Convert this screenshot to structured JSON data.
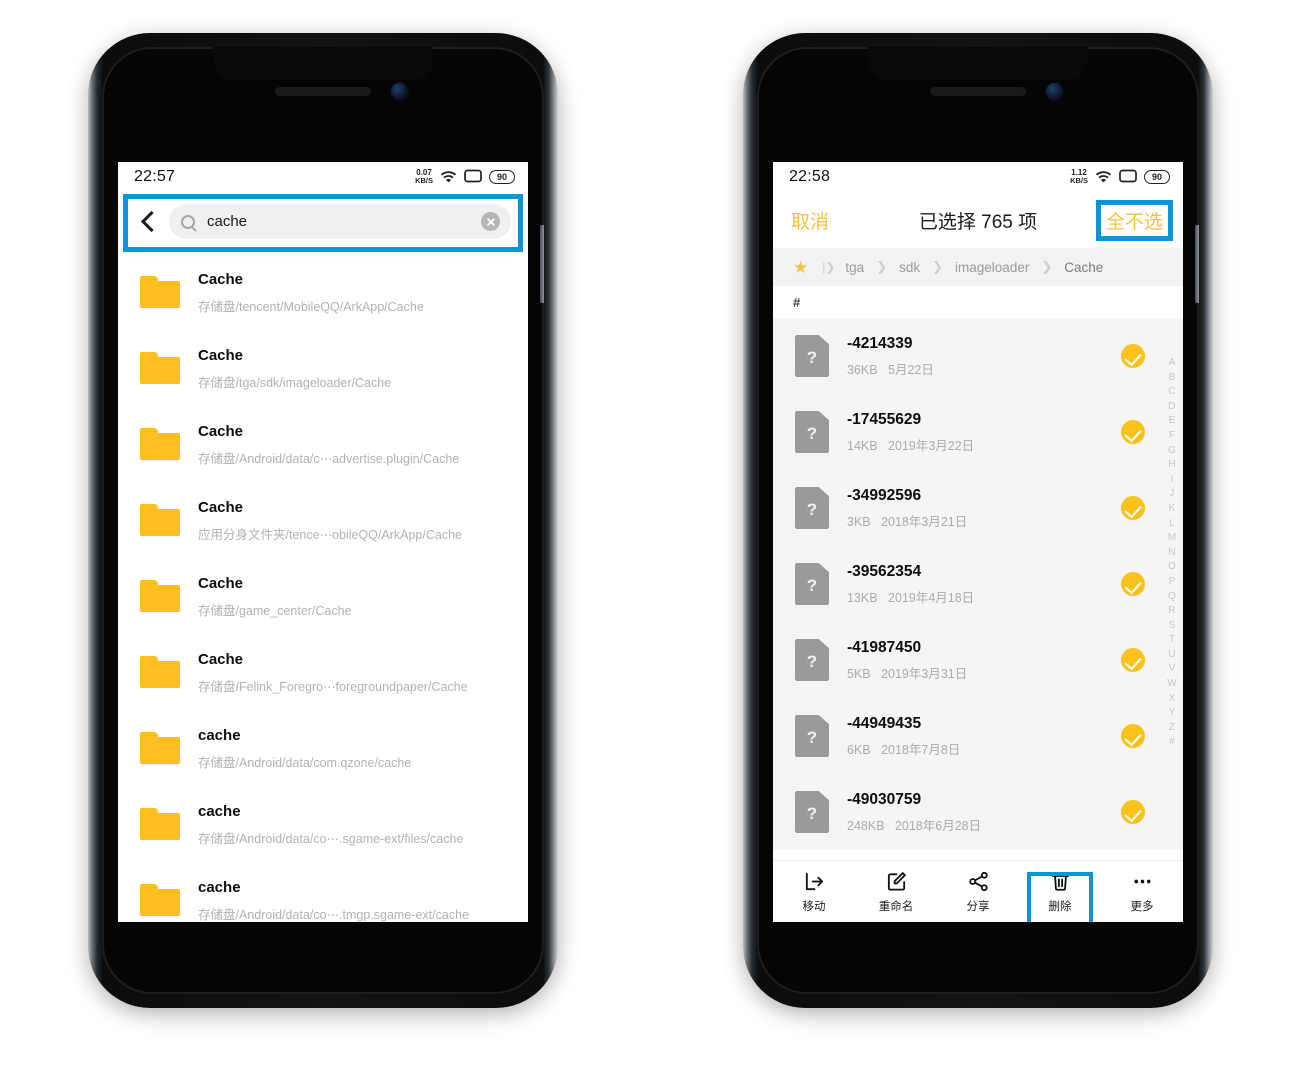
{
  "accent": {
    "highlight_blue": "#1093d6",
    "folder_yellow": "#fcbe20",
    "check_yellow": "#fdc11b",
    "text_yellow": "#f5c242"
  },
  "left_phone": {
    "status": {
      "time": "22:57",
      "net_speed_value": "0.07",
      "net_speed_unit": "KB/S",
      "wifi_icon": "wifi-icon",
      "sim_icon": "sim-icon",
      "battery": "90"
    },
    "search": {
      "back_icon": "back-chevron-icon",
      "search_icon": "search-icon",
      "value": "cache",
      "placeholder": "cache",
      "clear_icon": "clear-icon",
      "highlighted": true
    },
    "results": [
      {
        "icon": "folder-icon",
        "name": "Cache",
        "path": "存储盘/tencent/MobileQQ/ArkApp/Cache"
      },
      {
        "icon": "folder-icon",
        "name": "Cache",
        "path": "存储盘/tga/sdk/imageloader/Cache"
      },
      {
        "icon": "folder-icon",
        "name": "Cache",
        "path": "存储盘/Android/data/c⋯advertise.plugin/Cache"
      },
      {
        "icon": "folder-icon",
        "name": "Cache",
        "path": "应用分身文件夹/tence⋯obileQQ/ArkApp/Cache"
      },
      {
        "icon": "folder-icon",
        "name": "Cache",
        "path": "存储盘/game_center/Cache"
      },
      {
        "icon": "folder-icon",
        "name": "Cache",
        "path": "存储盘/Felink_Foregro⋯foregroundpaper/Cache"
      },
      {
        "icon": "folder-icon",
        "name": "cache",
        "path": "存储盘/Android/data/com.qzone/cache"
      },
      {
        "icon": "folder-icon",
        "name": "cache",
        "path": "存储盘/Android/data/co⋯.sgame-ext/files/cache"
      },
      {
        "icon": "folder-icon",
        "name": "cache",
        "path": "存储盘/Android/data/co⋯.tmgp.sgame-ext/cache"
      }
    ]
  },
  "right_phone": {
    "status": {
      "time": "22:58",
      "net_speed_value": "1.12",
      "net_speed_unit": "KB/S",
      "wifi_icon": "wifi-icon",
      "sim_icon": "sim-icon",
      "battery": "90"
    },
    "header": {
      "cancel_label": "取消",
      "title": "已选择 765 项",
      "deselect_all_label": "全不选",
      "deselect_highlighted": true
    },
    "breadcrumb": {
      "star_icon": "star-icon",
      "root_icon": "root-drive-icon",
      "items": [
        "tga",
        "sdk",
        "imageloader",
        "Cache"
      ],
      "separator": "❯"
    },
    "section_label": "#",
    "files": [
      {
        "icon": "unknown-file-icon",
        "name": "-4214339",
        "size": "36KB",
        "date": "5月22日",
        "selected": true
      },
      {
        "icon": "unknown-file-icon",
        "name": "-17455629",
        "size": "14KB",
        "date": "2019年3月22日",
        "selected": true
      },
      {
        "icon": "unknown-file-icon",
        "name": "-34992596",
        "size": "3KB",
        "date": "2018年3月21日",
        "selected": true
      },
      {
        "icon": "unknown-file-icon",
        "name": "-39562354",
        "size": "13KB",
        "date": "2019年4月18日",
        "selected": true
      },
      {
        "icon": "unknown-file-icon",
        "name": "-41987450",
        "size": "5KB",
        "date": "2019年3月31日",
        "selected": true
      },
      {
        "icon": "unknown-file-icon",
        "name": "-44949435",
        "size": "6KB",
        "date": "2018年7月8日",
        "selected": true
      },
      {
        "icon": "unknown-file-icon",
        "name": "-49030759",
        "size": "248KB",
        "date": "2018年6月28日",
        "selected": true
      }
    ],
    "alpha_index": [
      "A",
      "B",
      "C",
      "D",
      "E",
      "F",
      "G",
      "H",
      "I",
      "J",
      "K",
      "L",
      "M",
      "N",
      "O",
      "P",
      "Q",
      "R",
      "S",
      "T",
      "U",
      "V",
      "W",
      "X",
      "Y",
      "Z",
      "#"
    ],
    "toolbar": [
      {
        "icon": "move-icon",
        "label": "移动",
        "highlighted": false
      },
      {
        "icon": "rename-icon",
        "label": "重命名",
        "highlighted": false
      },
      {
        "icon": "share-icon",
        "label": "分享",
        "highlighted": false
      },
      {
        "icon": "trash-icon",
        "label": "删除",
        "highlighted": true
      },
      {
        "icon": "more-icon",
        "label": "更多",
        "highlighted": false
      }
    ]
  }
}
